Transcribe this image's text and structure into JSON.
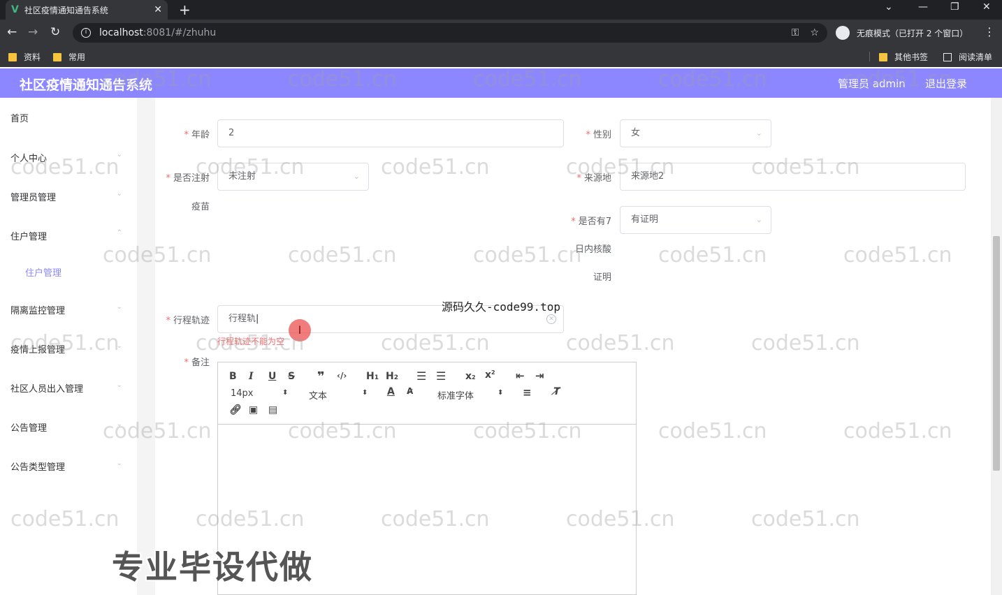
{
  "browser": {
    "tab_title": "社区疫情通知通告系统",
    "url_host": "localhost",
    "url_path": ":8081/#/zhuhu",
    "incognito_label": "无痕模式（已打开 2 个窗口）",
    "bookmarks": [
      "资料",
      "常用"
    ],
    "bookmarks_right": [
      "其他书签",
      "阅读清单"
    ]
  },
  "header": {
    "title": "社区疫情通知通告系统",
    "user": "管理员 admin",
    "logout": "退出登录"
  },
  "sidebar": {
    "items": [
      {
        "label": "首页"
      },
      {
        "label": "个人中心"
      },
      {
        "label": "管理员管理"
      },
      {
        "label": "住户管理"
      },
      {
        "label": "隔离监控管理"
      },
      {
        "label": "疫情上报管理"
      },
      {
        "label": "社区人员出入管理"
      },
      {
        "label": "公告管理"
      },
      {
        "label": "公告类型管理"
      }
    ],
    "sub_active": "住户管理"
  },
  "form": {
    "age": {
      "label": "年龄",
      "value": "2"
    },
    "gender": {
      "label": "性别",
      "value": "女"
    },
    "vaccine": {
      "label_line1": "是否注射",
      "label_line2": "疫苗",
      "value": "未注射"
    },
    "origin": {
      "label": "来源地",
      "value": "来源地2"
    },
    "nucleic": {
      "label_line1": "是否有7",
      "label_line2": "日内核酸",
      "label_line3": "证明",
      "value": "有证明"
    },
    "track": {
      "label": "行程轨迹",
      "value": "行程轨",
      "error": "行程轨迹不能为空"
    },
    "remark": {
      "label": "备注"
    }
  },
  "editor": {
    "font_size": "14px",
    "heading": "文本",
    "font_family": "标准字体"
  },
  "overlays": {
    "code_text": "源码久久-code99.top",
    "promo_text": "专业毕设代做",
    "watermark": "code51.cn"
  }
}
